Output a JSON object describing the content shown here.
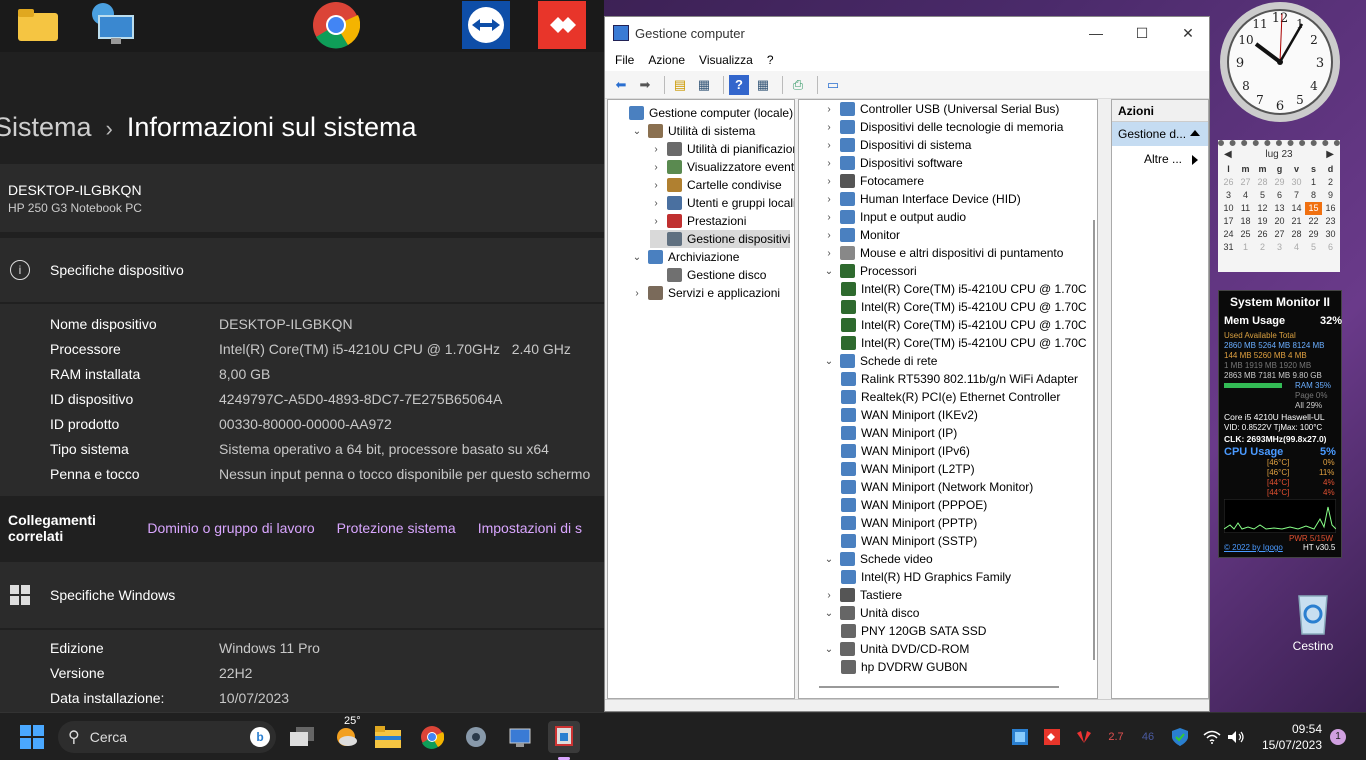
{
  "settings": {
    "breadcrumb_parent": "Sistema",
    "breadcrumb_sep": "›",
    "page_title": "Informazioni sul sistema",
    "device_name": "DESKTOP-ILGBKQN",
    "device_model": "HP 250 G3 Notebook PC",
    "spec_header": "Specifiche dispositivo",
    "specs": [
      {
        "label": "Nome dispositivo",
        "value": "DESKTOP-ILGBKQN"
      },
      {
        "label": "Processore",
        "value": "Intel(R) Core(TM) i5-4210U CPU @ 1.70GHz   2.40 GHz"
      },
      {
        "label": "RAM installata",
        "value": "8,00 GB"
      },
      {
        "label": "ID dispositivo",
        "value": "4249797C-A5D0-4893-8DC7-7E275B65064A"
      },
      {
        "label": "ID prodotto",
        "value": "00330-80000-00000-AA972"
      },
      {
        "label": "Tipo sistema",
        "value": "Sistema operativo a 64 bit, processore basato su x64"
      },
      {
        "label": "Penna e tocco",
        "value": "Nessun input penna o tocco disponibile per questo schermo"
      }
    ],
    "related_label": "Collegamenti correlati",
    "related_links": [
      "Dominio o gruppo di lavoro",
      "Protezione sistema",
      "Impostazioni di s"
    ],
    "windows_header": "Specifiche Windows",
    "windows_specs": [
      {
        "label": "Edizione",
        "value": "Windows 11 Pro"
      },
      {
        "label": "Versione",
        "value": "22H2"
      },
      {
        "label": "Data installazione:",
        "value": "10/07/2023"
      }
    ]
  },
  "cm": {
    "title": "Gestione computer",
    "menu": [
      "File",
      "Azione",
      "Visualizza",
      "?"
    ],
    "left_tree": [
      {
        "label": "Gestione computer (locale)",
        "level": 0,
        "exp": ""
      },
      {
        "label": "Utilità di sistema",
        "level": 1,
        "exp": "⌄"
      },
      {
        "label": "Utilità di pianificazione",
        "level": 2,
        "exp": "›"
      },
      {
        "label": "Visualizzatore eventi",
        "level": 2,
        "exp": "›"
      },
      {
        "label": "Cartelle condivise",
        "level": 2,
        "exp": "›"
      },
      {
        "label": "Utenti e gruppi locali",
        "level": 2,
        "exp": "›"
      },
      {
        "label": "Prestazioni",
        "level": 2,
        "exp": "›"
      },
      {
        "label": "Gestione dispositivi",
        "level": 2,
        "exp": "",
        "selected": true
      },
      {
        "label": "Archiviazione",
        "level": 1,
        "exp": "⌄"
      },
      {
        "label": "Gestione disco",
        "level": 2,
        "exp": ""
      },
      {
        "label": "Servizi e applicazioni",
        "level": 1,
        "exp": "›"
      }
    ],
    "device_tree": [
      {
        "label": "Controller USB (Universal Serial Bus)",
        "level": 0,
        "exp": "›"
      },
      {
        "label": "Dispositivi delle tecnologie di memoria",
        "level": 0,
        "exp": "›"
      },
      {
        "label": "Dispositivi di sistema",
        "level": 0,
        "exp": "›"
      },
      {
        "label": "Dispositivi software",
        "level": 0,
        "exp": "›"
      },
      {
        "label": "Fotocamere",
        "level": 0,
        "exp": "›"
      },
      {
        "label": "Human Interface Device (HID)",
        "level": 0,
        "exp": "›"
      },
      {
        "label": "Input e output audio",
        "level": 0,
        "exp": "›"
      },
      {
        "label": "Monitor",
        "level": 0,
        "exp": "›"
      },
      {
        "label": "Mouse e altri dispositivi di puntamento",
        "level": 0,
        "exp": "›"
      },
      {
        "label": "Processori",
        "level": 0,
        "exp": "⌄"
      },
      {
        "label": "Intel(R) Core(TM) i5-4210U CPU @ 1.70C",
        "level": 1,
        "exp": ""
      },
      {
        "label": "Intel(R) Core(TM) i5-4210U CPU @ 1.70C",
        "level": 1,
        "exp": ""
      },
      {
        "label": "Intel(R) Core(TM) i5-4210U CPU @ 1.70C",
        "level": 1,
        "exp": ""
      },
      {
        "label": "Intel(R) Core(TM) i5-4210U CPU @ 1.70C",
        "level": 1,
        "exp": ""
      },
      {
        "label": "Schede di rete",
        "level": 0,
        "exp": "⌄"
      },
      {
        "label": "Ralink RT5390 802.11b/g/n WiFi Adapter",
        "level": 1,
        "exp": ""
      },
      {
        "label": "Realtek(R) PCI(e) Ethernet Controller",
        "level": 1,
        "exp": ""
      },
      {
        "label": "WAN Miniport (IKEv2)",
        "level": 1,
        "exp": ""
      },
      {
        "label": "WAN Miniport (IP)",
        "level": 1,
        "exp": ""
      },
      {
        "label": "WAN Miniport (IPv6)",
        "level": 1,
        "exp": ""
      },
      {
        "label": "WAN Miniport (L2TP)",
        "level": 1,
        "exp": ""
      },
      {
        "label": "WAN Miniport (Network Monitor)",
        "level": 1,
        "exp": ""
      },
      {
        "label": "WAN Miniport (PPPOE)",
        "level": 1,
        "exp": ""
      },
      {
        "label": "WAN Miniport (PPTP)",
        "level": 1,
        "exp": ""
      },
      {
        "label": "WAN Miniport (SSTP)",
        "level": 1,
        "exp": ""
      },
      {
        "label": "Schede video",
        "level": 0,
        "exp": "⌄"
      },
      {
        "label": "Intel(R) HD Graphics Family",
        "level": 1,
        "exp": ""
      },
      {
        "label": "Tastiere",
        "level": 0,
        "exp": "›"
      },
      {
        "label": "Unità disco",
        "level": 0,
        "exp": "⌄"
      },
      {
        "label": "PNY 120GB SATA SSD",
        "level": 1,
        "exp": ""
      },
      {
        "label": "Unità DVD/CD-ROM",
        "level": 0,
        "exp": "⌄"
      },
      {
        "label": "hp DVDRW  GUB0N",
        "level": 1,
        "exp": ""
      }
    ],
    "actions_header": "Azioni",
    "actions_selected": "Gestione d...",
    "actions_more": "Altre ..."
  },
  "calendar": {
    "month": "lug 23",
    "weekdays": [
      "l",
      "m",
      "m",
      "g",
      "v",
      "s",
      "d"
    ],
    "days": [
      "26",
      "27",
      "28",
      "29",
      "30",
      "1",
      "2",
      "3",
      "4",
      "5",
      "6",
      "7",
      "8",
      "9",
      "10",
      "11",
      "12",
      "13",
      "14",
      "15",
      "16",
      "17",
      "18",
      "19",
      "20",
      "21",
      "22",
      "23",
      "24",
      "25",
      "26",
      "27",
      "28",
      "29",
      "30",
      "31",
      "1",
      "2",
      "3",
      "4",
      "5",
      "6"
    ],
    "today": "15"
  },
  "sysmon": {
    "title": "System Monitor II",
    "mem_label": "Mem Usage",
    "mem_pct": "32%",
    "cols": "Used   Available   Total",
    "mem_rows": [
      "2860 MB  5264 MB  8124 MB",
      "144 MB  5260 MB  4 MB",
      "1 MB  1919 MB  1920 MB",
      "2863 MB  7181 MB  9.80 GB"
    ],
    "ram": "RAM  35%",
    "page": "Page  0%",
    "all": "All  29%",
    "cpu_name": "Core i5 4210U Haswell-UL",
    "vid": "VID: 0.8522V TjMax: 100°C",
    "clk": "CLK:  2693MHz(99.8x27.0)",
    "cpu_label": "CPU Usage",
    "cpu_pct": "5%",
    "cores": [
      {
        "temp": "[46°C]",
        "pct": "0%"
      },
      {
        "temp": "[46°C]",
        "pct": "11%"
      },
      {
        "temp": "[44°C]",
        "pct": "4%"
      },
      {
        "temp": "[44°C]",
        "pct": "4%"
      }
    ],
    "pwr": "PWR 5/15W",
    "footer_link": "© 2022 by Igogo",
    "footer_ver": "HT v30.5"
  },
  "trash_label": "Cestino",
  "taskbar": {
    "search_placeholder": "Cerca",
    "weather_temp": "25°",
    "time": "09:54",
    "date": "15/07/2023",
    "tray_num1": "2.7",
    "tray_num2": "46",
    "notification_count": "1"
  }
}
